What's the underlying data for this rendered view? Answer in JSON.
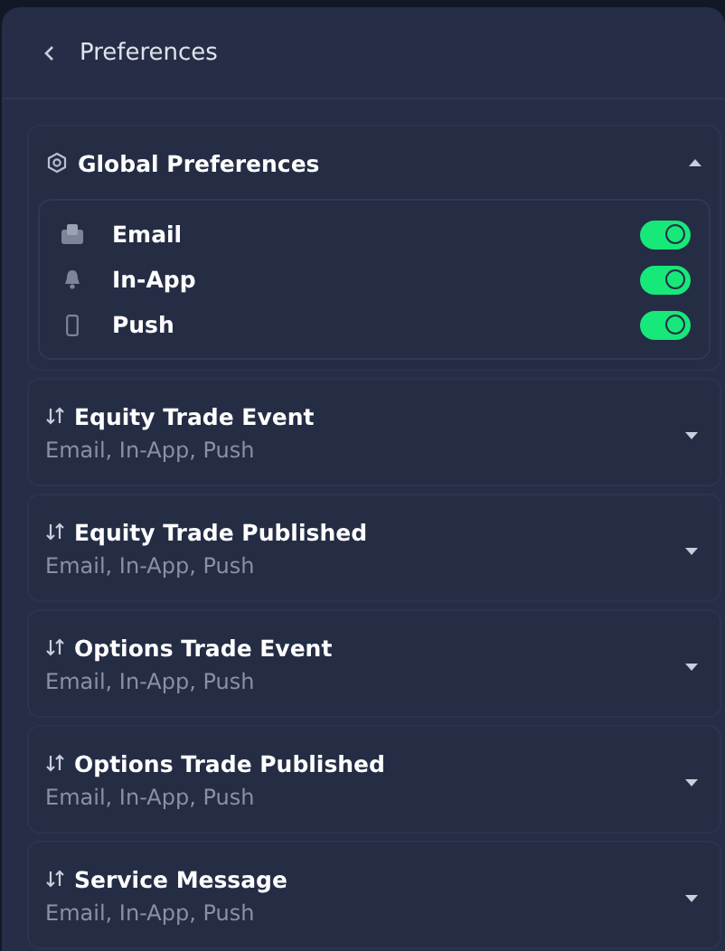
{
  "header": {
    "title": "Preferences"
  },
  "global": {
    "title": "Global Preferences",
    "expanded": true,
    "channels": [
      {
        "kind": "email",
        "label": "Email",
        "on": true
      },
      {
        "kind": "bell",
        "label": "In-App",
        "on": true
      },
      {
        "kind": "phone",
        "label": "Push",
        "on": true
      }
    ]
  },
  "events": [
    {
      "title": "Equity Trade Event",
      "summary": "Email, In-App, Push",
      "expanded": false
    },
    {
      "title": "Equity Trade Published",
      "summary": "Email, In-App, Push",
      "expanded": false
    },
    {
      "title": "Options Trade Event",
      "summary": "Email, In-App, Push",
      "expanded": false
    },
    {
      "title": "Options Trade Published",
      "summary": "Email, In-App, Push",
      "expanded": false
    },
    {
      "title": "Service Message",
      "summary": "Email, In-App, Push",
      "expanded": false
    }
  ]
}
